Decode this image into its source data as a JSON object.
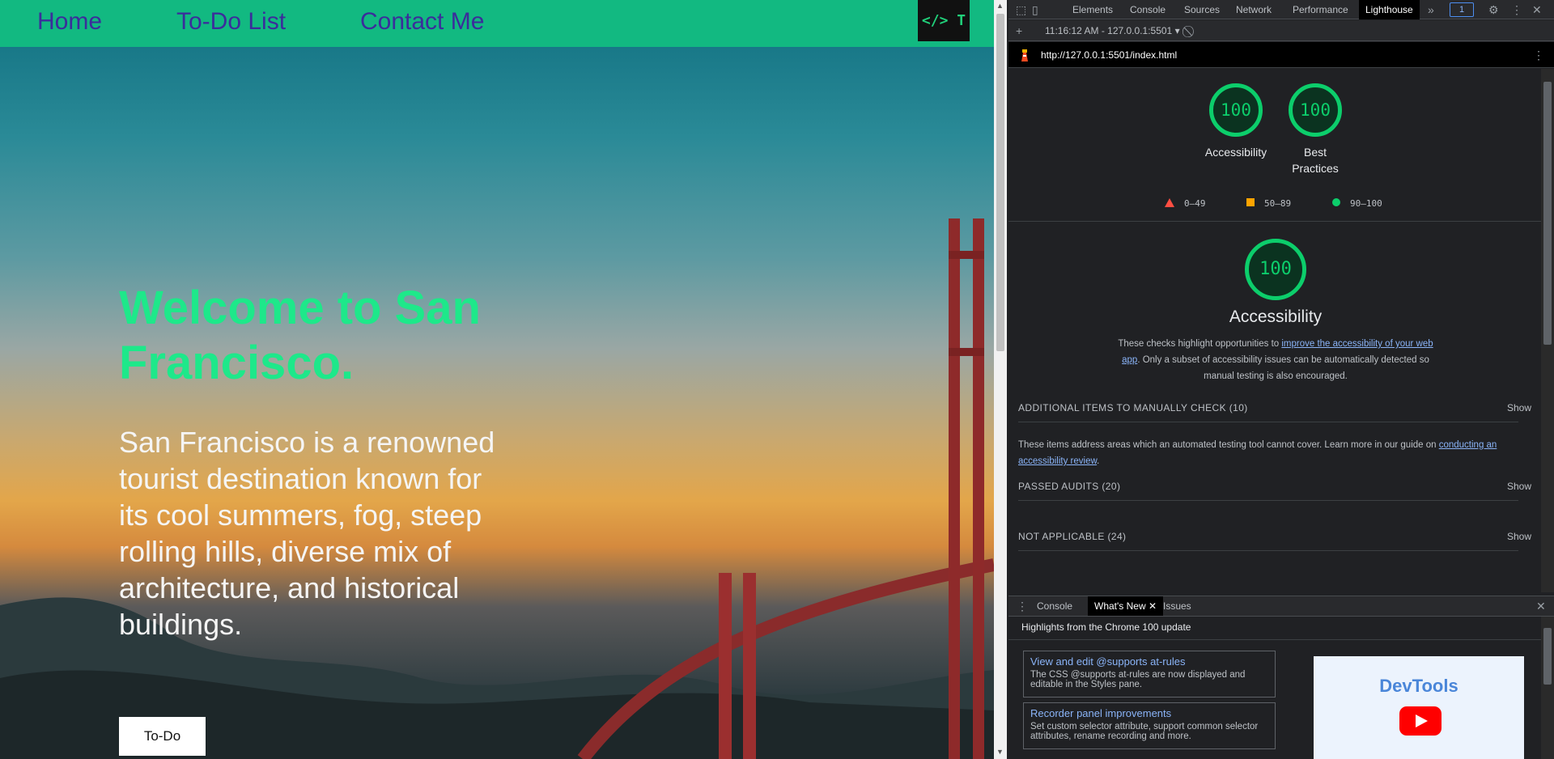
{
  "site": {
    "nav": {
      "home": "Home",
      "todo_list": "To-Do List",
      "contact": "Contact Me",
      "logo": "</> T"
    },
    "hero": {
      "title": "Welcome to San Francisco.",
      "text": "San Francisco is a renowned tourist destination known for its cool summers, fog, steep rolling hills, diverse mix of architecture, and historical buildings.",
      "button": "To-Do"
    }
  },
  "devtools": {
    "tabs": [
      "Elements",
      "Console",
      "Sources",
      "Network",
      "Performance",
      "Lighthouse"
    ],
    "active_tab": "Lighthouse",
    "more_tabs": "»",
    "issues_count": "1",
    "report_select": "11:16:12 AM - 127.0.0.1:5501 ▾",
    "url": "http://127.0.0.1:5501/index.html",
    "scores": [
      {
        "value": "100",
        "label": "Accessibility"
      },
      {
        "value": "100",
        "label": "Best Practices"
      }
    ],
    "legend": [
      {
        "range": "0–49",
        "color": "#ff4e42"
      },
      {
        "range": "50–89",
        "color": "#ffa400"
      },
      {
        "range": "90–100",
        "color": "#0cce6b"
      }
    ],
    "category": {
      "score": "100",
      "title": "Accessibility",
      "desc_before": "These checks highlight opportunities to ",
      "desc_link": "improve the accessibility of your web app",
      "desc_after": ". Only a subset of accessibility issues can be automatically detected so manual testing is also encouraged."
    },
    "groups": {
      "manual": "ADDITIONAL ITEMS TO MANUALLY CHECK (10)",
      "manual_desc_before": "These items address areas which an automated testing tool cannot cover. Learn more in our guide on ",
      "manual_desc_link": "conducting an accessibility review",
      "manual_desc_after": ".",
      "passed": "PASSED AUDITS (20)",
      "not_applicable": "NOT APPLICABLE (24)",
      "show": "Show"
    },
    "drawer": {
      "tabs": [
        "Console",
        "What's New",
        "Issues"
      ],
      "active_tab": "What's New",
      "heading": "Highlights from the Chrome 100 update",
      "cards": [
        {
          "title": "View and edit @supports at-rules",
          "desc": "The CSS @supports at-rules are now displayed and editable in the Styles pane."
        },
        {
          "title": "Recorder panel improvements",
          "desc": "Set custom selector attribute, support common selector attributes, rename recording and more."
        }
      ],
      "promo_title": "DevTools"
    },
    "colors": {
      "pass": "#0cce6b",
      "average": "#ffa400",
      "fail": "#ff4e42",
      "link": "#8ab4f8"
    }
  }
}
